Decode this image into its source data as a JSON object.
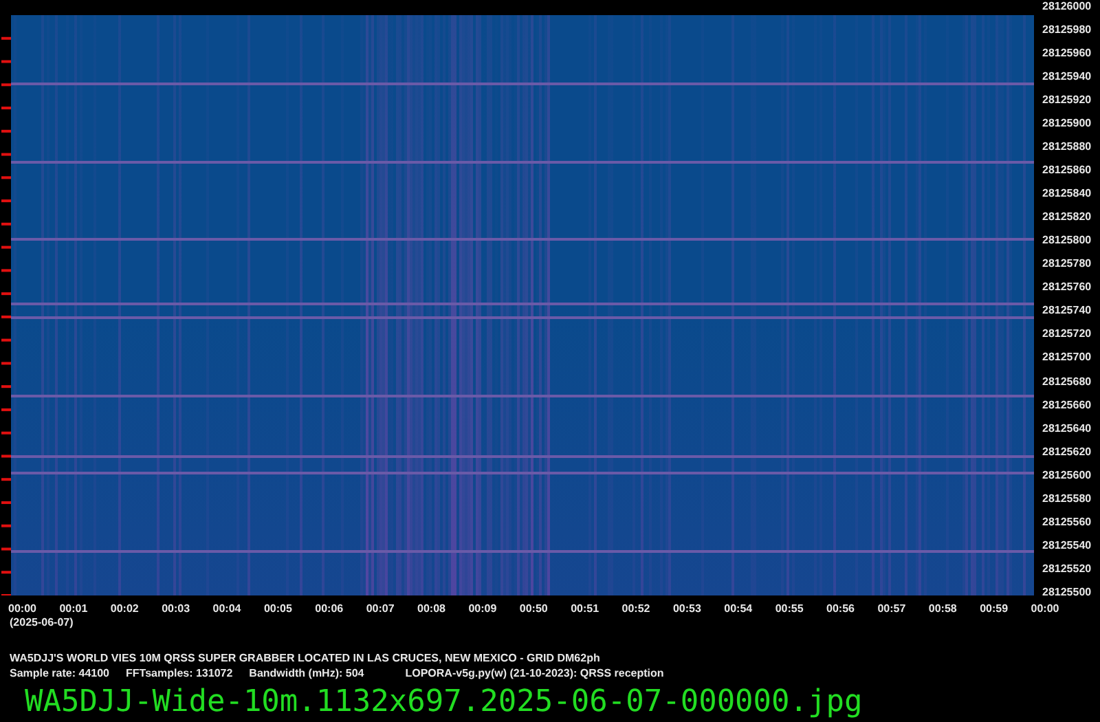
{
  "frequency_axis": {
    "labels": [
      "28126000",
      "28125980",
      "28125960",
      "28125940",
      "28125920",
      "28125900",
      "28125880",
      "28125860",
      "28125840",
      "28125820",
      "28125800",
      "28125780",
      "28125760",
      "28125740",
      "28125720",
      "28125700",
      "28125680",
      "28125660",
      "28125640",
      "28125620",
      "28125600",
      "28125580",
      "28125560",
      "28125540",
      "28125520",
      "28125500"
    ]
  },
  "time_axis": {
    "labels": [
      "00:00",
      "00:01",
      "00:02",
      "00:03",
      "00:04",
      "00:05",
      "00:06",
      "00:07",
      "00:08",
      "00:09",
      "00:50",
      "00:51",
      "00:52",
      "00:53",
      "00:54",
      "00:55",
      "00:56",
      "00:57",
      "00:58",
      "00:59",
      "00:00"
    ],
    "date": "(2025-06-07)"
  },
  "caption": {
    "title": "WA5DJJ'S WORLD VIES 10M QRSS SUPER GRABBER LOCATED IN LAS CRUCES, NEW MEXICO - GRID DM62ph",
    "info": [
      "Sample rate: 44100",
      "FFTsamples: 131072",
      "Bandwidth (mHz): 504",
      "LOPORA-v5g.py(w) (21-10-2023): QRSS reception"
    ]
  },
  "filename": "WA5DJJ-Wide-10m.1132x697.2025-06-07-000000.jpg"
}
